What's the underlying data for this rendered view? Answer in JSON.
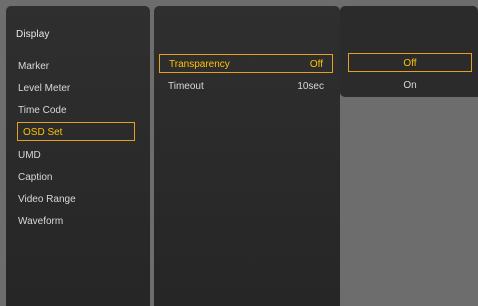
{
  "menu": {
    "header": "Display",
    "items": [
      "Marker",
      "Level Meter",
      "Time Code",
      "OSD Set",
      "UMD",
      "Caption",
      "Video Range",
      "Waveform"
    ],
    "selected_index": 3
  },
  "submenu": {
    "rows": [
      {
        "label": "Transparency",
        "value": "Off"
      },
      {
        "label": "Timeout",
        "value": "10sec"
      }
    ],
    "selected_index": 0
  },
  "options": {
    "items": [
      "Off",
      "On"
    ],
    "selected_index": 0
  },
  "colors": {
    "highlight_border": "#e3a11f",
    "highlight_text": "#ffc300",
    "panel_background": "#2a2a2a",
    "screen_background": "#6d6d6d"
  }
}
